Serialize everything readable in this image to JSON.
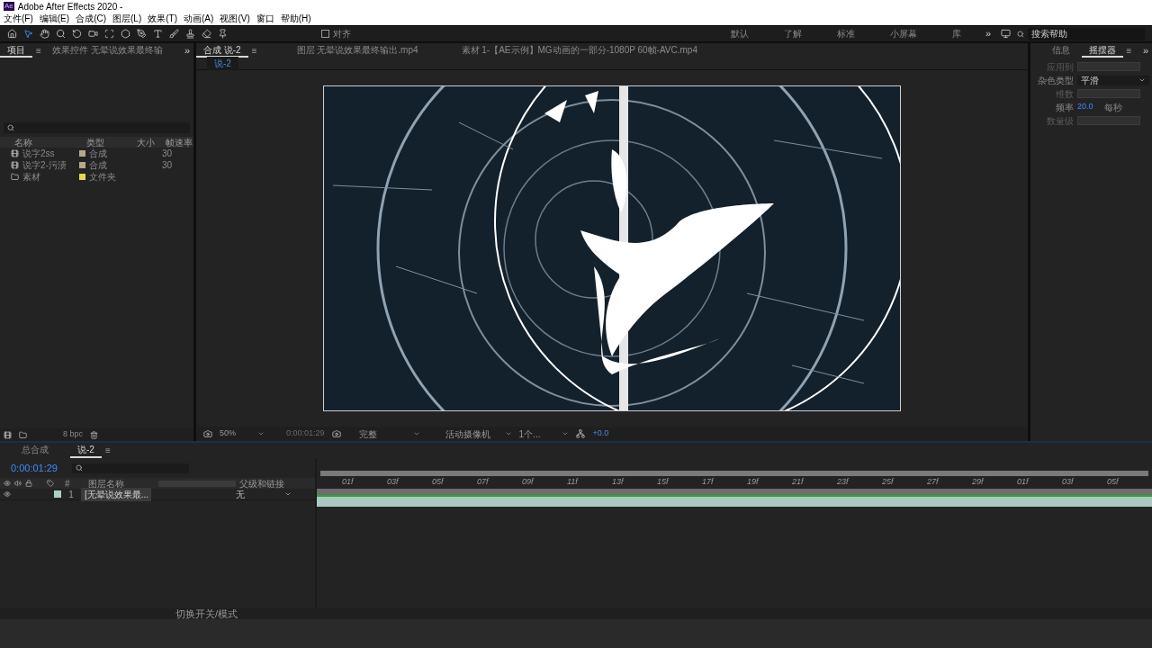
{
  "window": {
    "app_icon": "Ae",
    "title": "Adobe After Effects 2020 -"
  },
  "menu": [
    "文件(F)",
    "编辑(E)",
    "合成(C)",
    "图层(L)",
    "效果(T)",
    "动画(A)",
    "视图(V)",
    "窗口",
    "帮助(H)"
  ],
  "toolbar": {
    "snap": {
      "label": "对齐",
      "checked": false
    },
    "workspaces": [
      {
        "label": "默认",
        "selected": false
      },
      {
        "label": "了解",
        "selected": false
      },
      {
        "label": "标准",
        "selected": false
      },
      {
        "label": "小屏幕",
        "selected": false
      },
      {
        "label": "库",
        "selected": false
      }
    ],
    "more": "»",
    "search": {
      "placeholder": "搜索帮助"
    }
  },
  "project_panel": {
    "tabs": [
      {
        "label": "项目",
        "selected": true,
        "menu": "≡"
      },
      {
        "label": "效果控件 无晕说效果最终输",
        "selected": false
      }
    ],
    "more": "»",
    "columns": [
      "名称",
      "类型",
      "大小",
      "帧速率"
    ],
    "rows": [
      {
        "kind": "comp",
        "name": "说字2ss",
        "color": "#b5ab8a",
        "type": "合成",
        "frame_rate": "30"
      },
      {
        "kind": "comp",
        "name": "说字2-污渍",
        "color": "#b5ab8a",
        "type": "合成",
        "frame_rate": "30"
      },
      {
        "kind": "folder",
        "name": "素材",
        "color": "#e3d94b",
        "type": "文件夹",
        "frame_rate": ""
      }
    ],
    "bpc": "8 bpc"
  },
  "viewer": {
    "tabs": [
      {
        "label": "合成 说-2",
        "selected": true,
        "menu": "≡"
      },
      {
        "label": "图层 无晕说效果最终输出.mp4",
        "selected": false
      },
      {
        "label": "素材 1-【AE示例】MG动画的一部分-1080P 60帧-AVC.mp4",
        "selected": false
      }
    ],
    "breadcrumb": "说-2",
    "zoom": "50%",
    "timecode": "0:00:01:29",
    "resolution": "完整",
    "camera": "活动摄像机",
    "views": "1个...",
    "exposure": "+0.0"
  },
  "wiggler": {
    "tabs": [
      {
        "label": "信息",
        "selected": false
      },
      {
        "label": "摇摆器",
        "selected": true,
        "menu": "≡"
      }
    ],
    "more": "»",
    "fields": [
      {
        "kind": "blank",
        "label": "应用到",
        "disabled": true
      },
      {
        "kind": "dropdown",
        "label": "杂色类型",
        "value": "平滑",
        "disabled": false
      },
      {
        "kind": "blank",
        "label": "维数",
        "disabled": true
      },
      {
        "kind": "number",
        "label": "频率",
        "value": "20.0",
        "unit": "每秒",
        "disabled": false
      },
      {
        "kind": "blank",
        "label": "数量级",
        "disabled": true
      }
    ]
  },
  "timeline": {
    "tabs": [
      {
        "label": "总合成",
        "selected": false
      },
      {
        "label": "说-2",
        "selected": true,
        "menu": "≡"
      }
    ],
    "timecode": "0:00:01:29",
    "columns": {
      "number": "#",
      "name": "图层名称",
      "parent": "父级和链接"
    },
    "layers": [
      {
        "number": "1",
        "name": "[无晕说效果最...",
        "parent": "无",
        "visible": true,
        "color": "#a9d1c8"
      }
    ],
    "ruler": [
      "01f",
      "03f",
      "05f",
      "07f",
      "09f",
      "11f",
      "13f",
      "15f",
      "17f",
      "19f",
      "21f",
      "23f",
      "25f",
      "27f",
      "29f",
      "01f",
      "03f",
      "05f"
    ],
    "footer": "切换开关/模式"
  }
}
